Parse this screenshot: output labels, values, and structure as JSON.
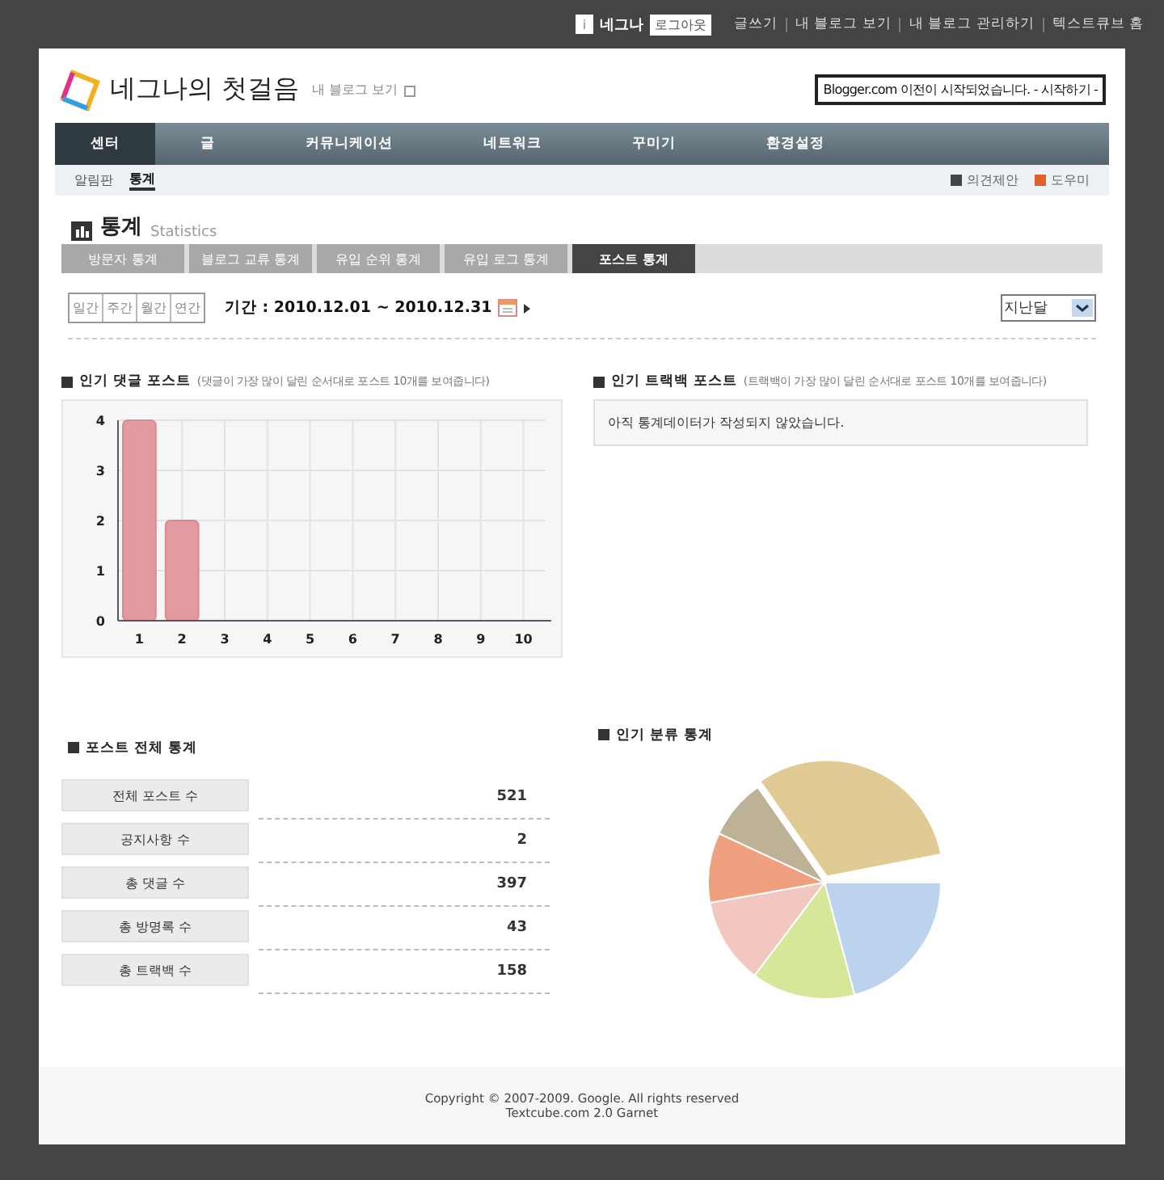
{
  "top_bar": {
    "user_mark": "i",
    "user": "네그나",
    "logout": "로그아웃",
    "links": [
      "글쓰기",
      "내 블로그 보기",
      "내 블로그 관리하기",
      "텍스트큐브 홈"
    ]
  },
  "header": {
    "blog_title": "네그나의 첫걸음",
    "view_link": "내 블로그 보기",
    "notice": "Blogger.com 이전이 시작되었습니다. - 시작하기 -"
  },
  "main_nav": [
    {
      "label": "센터",
      "selected": true
    },
    {
      "label": "글",
      "selected": false
    },
    {
      "label": "커뮤니케이션",
      "selected": false
    },
    {
      "label": "네트워크",
      "selected": false
    },
    {
      "label": "꾸미기",
      "selected": false
    },
    {
      "label": "환경설정",
      "selected": false
    }
  ],
  "sub_nav": [
    {
      "label": "알림판",
      "selected": false
    },
    {
      "label": "통계",
      "selected": true
    }
  ],
  "sub_links": [
    "의견제안",
    "도우미"
  ],
  "page_title": "통계",
  "page_subtitle": "Statistics",
  "tabs": [
    {
      "label": "방문자 통계",
      "selected": false
    },
    {
      "label": "블로그 교류 통계",
      "selected": false
    },
    {
      "label": "유입 순위 통계",
      "selected": false
    },
    {
      "label": "유입 로그 통계",
      "selected": false
    },
    {
      "label": "포스트 통계",
      "selected": true
    }
  ],
  "periods": [
    "일간",
    "주간",
    "월간",
    "연간"
  ],
  "range": "기간 : 2010.12.01 ~ 2010.12.31",
  "range_select": "지난달",
  "comments_panel": {
    "title": "인기 댓글 포스트",
    "hint": "(댓글이 가장 많이 달린 순서대로 포스트 10개를 보여줍니다)",
    "chart_data": {
      "type": "bar",
      "categories": [
        "1",
        "2",
        "3",
        "4",
        "5",
        "6",
        "7",
        "8",
        "9",
        "10"
      ],
      "values": [
        4,
        2,
        0,
        0,
        0,
        0,
        0,
        0,
        0,
        0
      ],
      "ylim": [
        0,
        4
      ],
      "grid": true,
      "yticks": [
        0,
        1,
        2,
        3,
        4
      ]
    }
  },
  "trackback_panel": {
    "title": "인기 트랙백 포스트",
    "hint": "(트랙백이 가장 많이 달린 순서대로 포스트 10개를 보여줍니다)",
    "message": "아직 통계데이터가 작성되지 않았습니다."
  },
  "totals": {
    "title": "포스트 전체 통계",
    "rows": [
      {
        "label": "전체 포스트 수",
        "value": "521"
      },
      {
        "label": "공지사항 수",
        "value": "2"
      },
      {
        "label": "총 댓글 수",
        "value": "397"
      },
      {
        "label": "총 방명록 수",
        "value": "43"
      },
      {
        "label": "총 트랙백 수",
        "value": "158"
      }
    ]
  },
  "category_panel": {
    "title": "인기 분류 통계"
  },
  "footer": [
    "Copyright © 2007-2009. Google. All rights reserved",
    "Textcube.com 2.0 Garnet"
  ]
}
